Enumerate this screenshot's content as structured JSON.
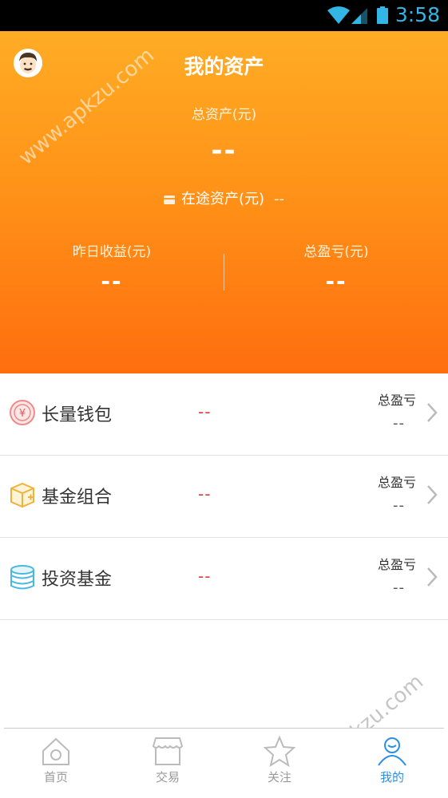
{
  "status_bar": {
    "time": "3:58"
  },
  "header": {
    "title": "我的资产",
    "total_assets_label": "总资产(元)",
    "total_assets_value": "--",
    "in_transit_label": "在途资产(元)",
    "in_transit_value": "--",
    "yesterday_income_label": "昨日收益(元)",
    "yesterday_income_value": "--",
    "total_pl_label": "总盈亏(元)",
    "total_pl_value": "--"
  },
  "products": [
    {
      "name": "长量钱包",
      "amount": "--",
      "pl_label": "总盈亏",
      "pl_value": "--",
      "icon": "yuan-coin-icon"
    },
    {
      "name": "基金组合",
      "amount": "--",
      "pl_label": "总盈亏",
      "pl_value": "--",
      "icon": "box-icon"
    },
    {
      "name": "投资基金",
      "amount": "--",
      "pl_label": "总盈亏",
      "pl_value": "--",
      "icon": "coin-stack-icon"
    }
  ],
  "tabs": [
    {
      "label": "首页",
      "icon": "home-icon",
      "active": false
    },
    {
      "label": "交易",
      "icon": "shop-icon",
      "active": false
    },
    {
      "label": "关注",
      "icon": "star-icon",
      "active": false
    },
    {
      "label": "我的",
      "icon": "user-icon",
      "active": true
    }
  ],
  "watermark": "www.apkzu.com",
  "colors": {
    "header_top": "#ffac25",
    "header_bottom": "#ff6e0f",
    "amount_red": "#e53935",
    "active_tab": "#2a8fe6"
  }
}
